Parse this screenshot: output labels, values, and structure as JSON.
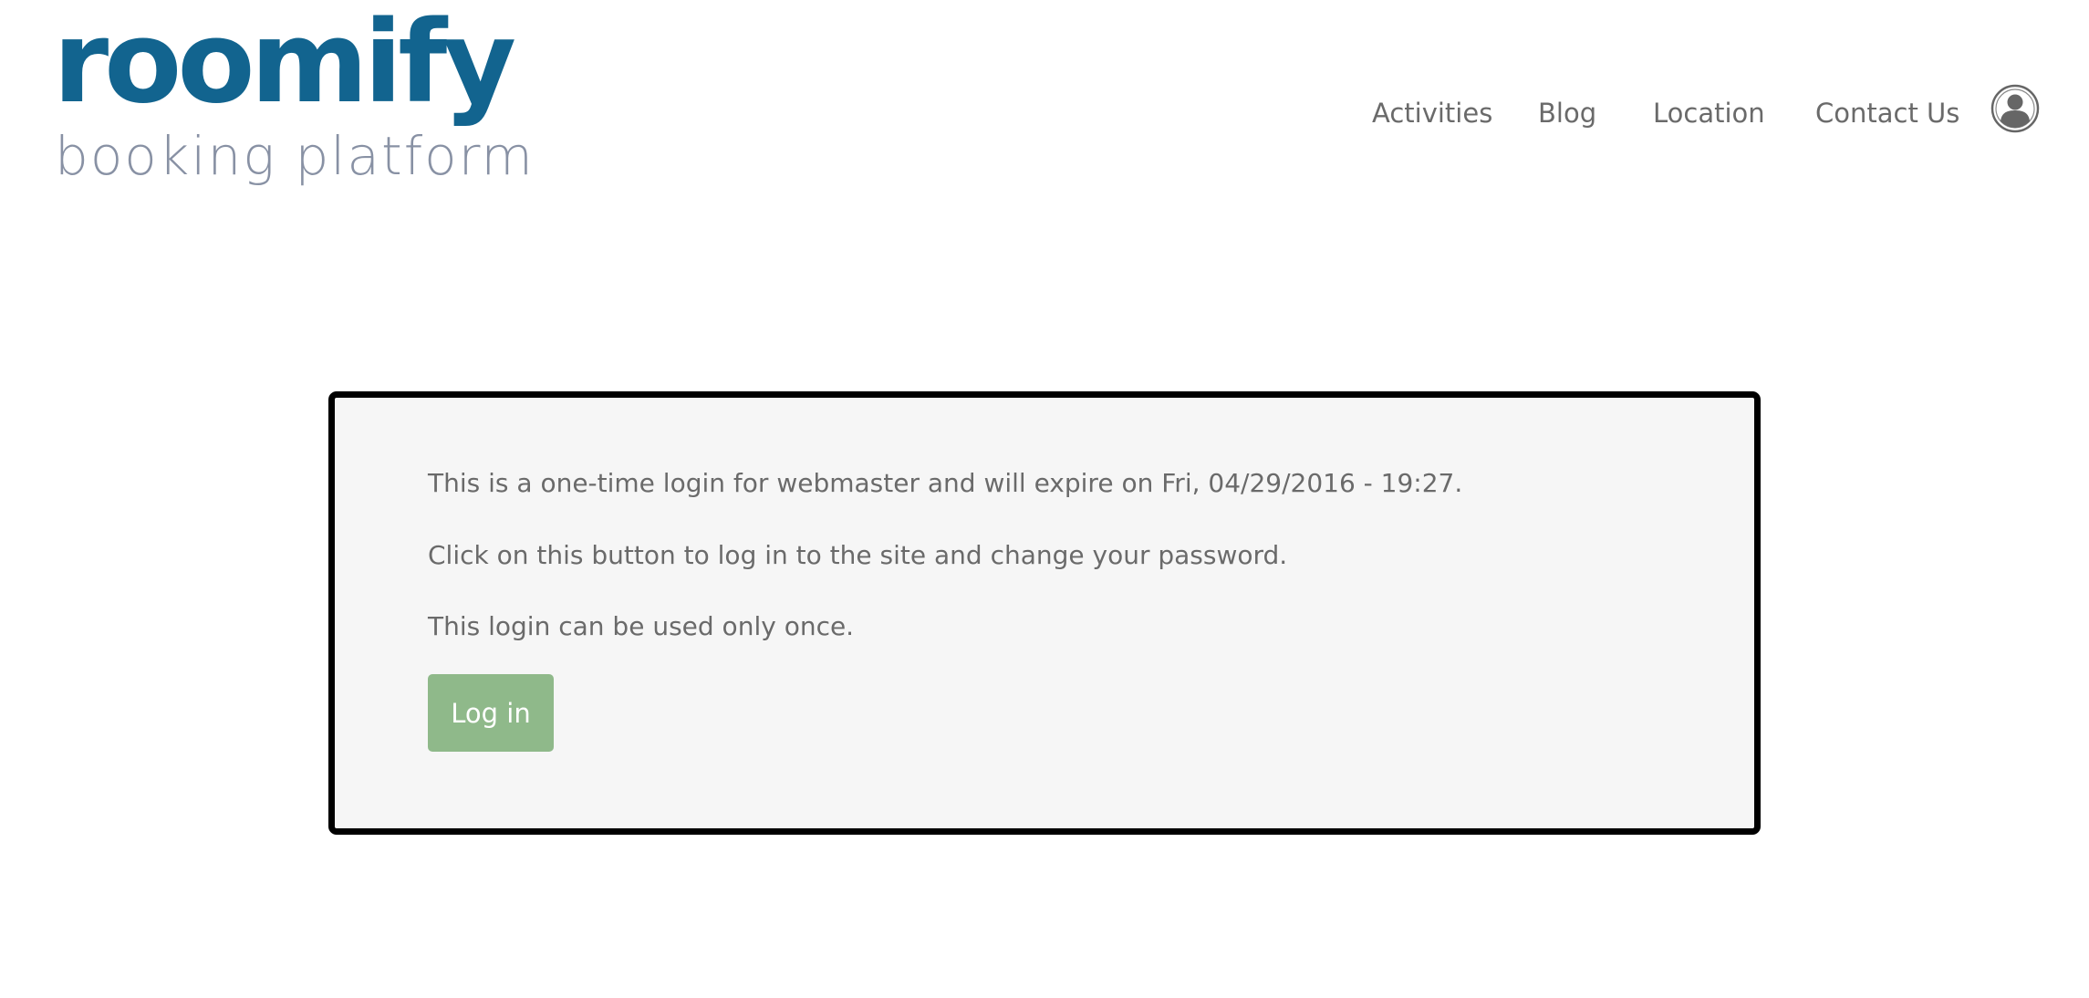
{
  "brand": {
    "name": "roomify",
    "tagline": "booking platform",
    "primary_color": "#12648f",
    "tagline_color": "#8891a4"
  },
  "nav": {
    "items": [
      {
        "label": "Activities"
      },
      {
        "label": "Blog"
      },
      {
        "label": "Location"
      },
      {
        "label": "Contact Us"
      }
    ],
    "user_icon": "user-account-icon"
  },
  "login_panel": {
    "message_1": "This is a one-time login for webmaster and will expire on Fri, 04/29/2016 - 19:27.",
    "message_2": "Click on this button to log in to the site and change your password.",
    "message_3": "This login can be used only once.",
    "button_label": "Log in",
    "button_color": "#8fb98a"
  }
}
